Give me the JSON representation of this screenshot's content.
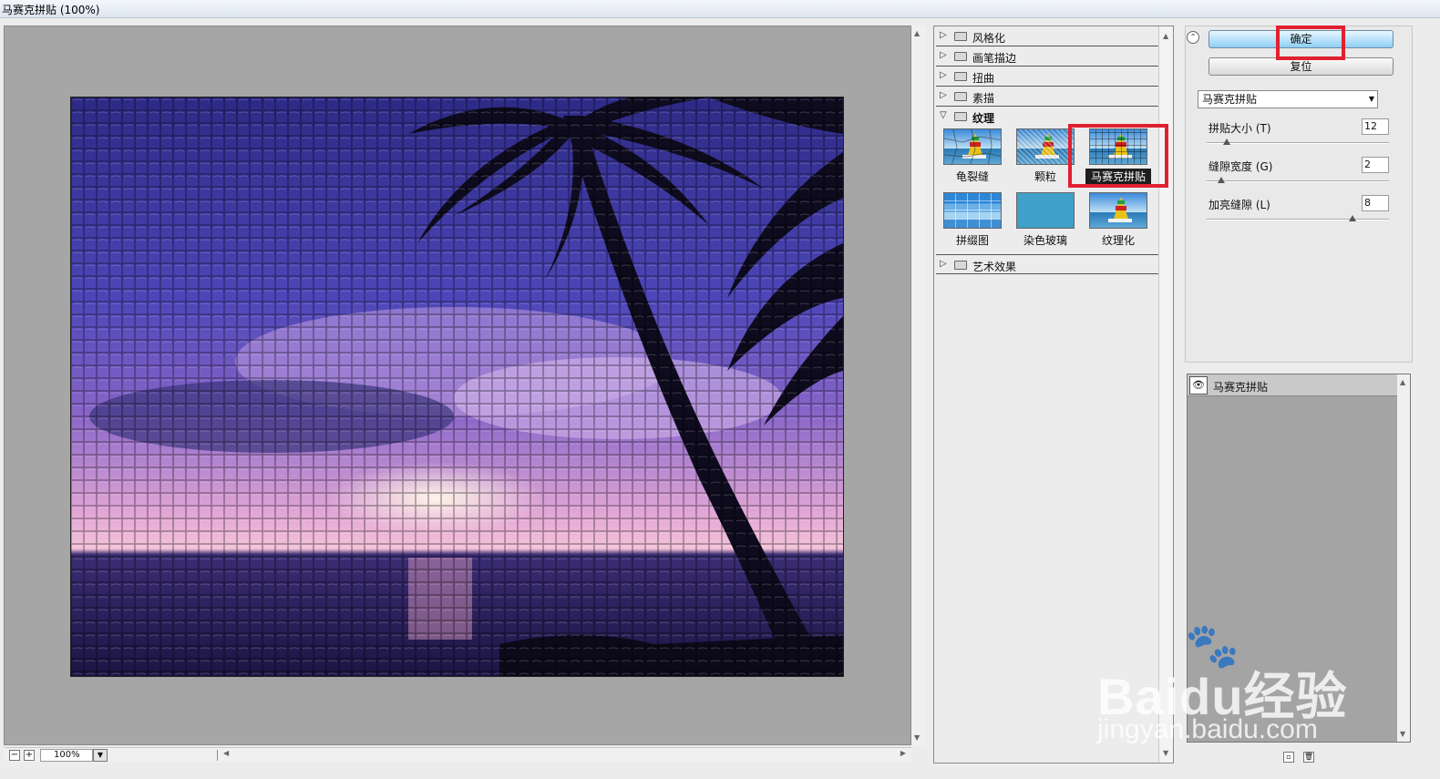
{
  "window": {
    "title": "马赛克拼贴 (100%)"
  },
  "preview": {
    "zoom": "100%"
  },
  "filter_gallery": {
    "categories": [
      {
        "label": "风格化",
        "expanded": false
      },
      {
        "label": "画笔描边",
        "expanded": false
      },
      {
        "label": "扭曲",
        "expanded": false
      },
      {
        "label": "素描",
        "expanded": false
      },
      {
        "label": "纹理",
        "expanded": true
      },
      {
        "label": "艺术效果",
        "expanded": false
      }
    ],
    "texture_filters": [
      {
        "label": "龟裂缝"
      },
      {
        "label": "颗粒"
      },
      {
        "label": "马赛克拼贴",
        "selected": true
      },
      {
        "label": "拼缀图"
      },
      {
        "label": "染色玻璃"
      },
      {
        "label": "纹理化"
      }
    ]
  },
  "actions": {
    "ok_label": "确定",
    "reset_label": "复位"
  },
  "settings": {
    "filter_select": "马赛克拼贴",
    "params": [
      {
        "label": "拼贴大小 (T)",
        "value": "12",
        "level": 0.12
      },
      {
        "label": "缝隙宽度 (G)",
        "value": "2",
        "level": 0.1
      },
      {
        "label": "加亮缝隙 (L)",
        "value": "8",
        "level": 0.8
      }
    ]
  },
  "layers": {
    "items": [
      {
        "label": "马赛克拼贴"
      }
    ]
  },
  "watermark": {
    "brand": "Baidu经验",
    "url": "jingyan.baidu.com"
  },
  "colors": {
    "highlight_box": "#e02030",
    "ok_button": "#8fd0f5"
  }
}
